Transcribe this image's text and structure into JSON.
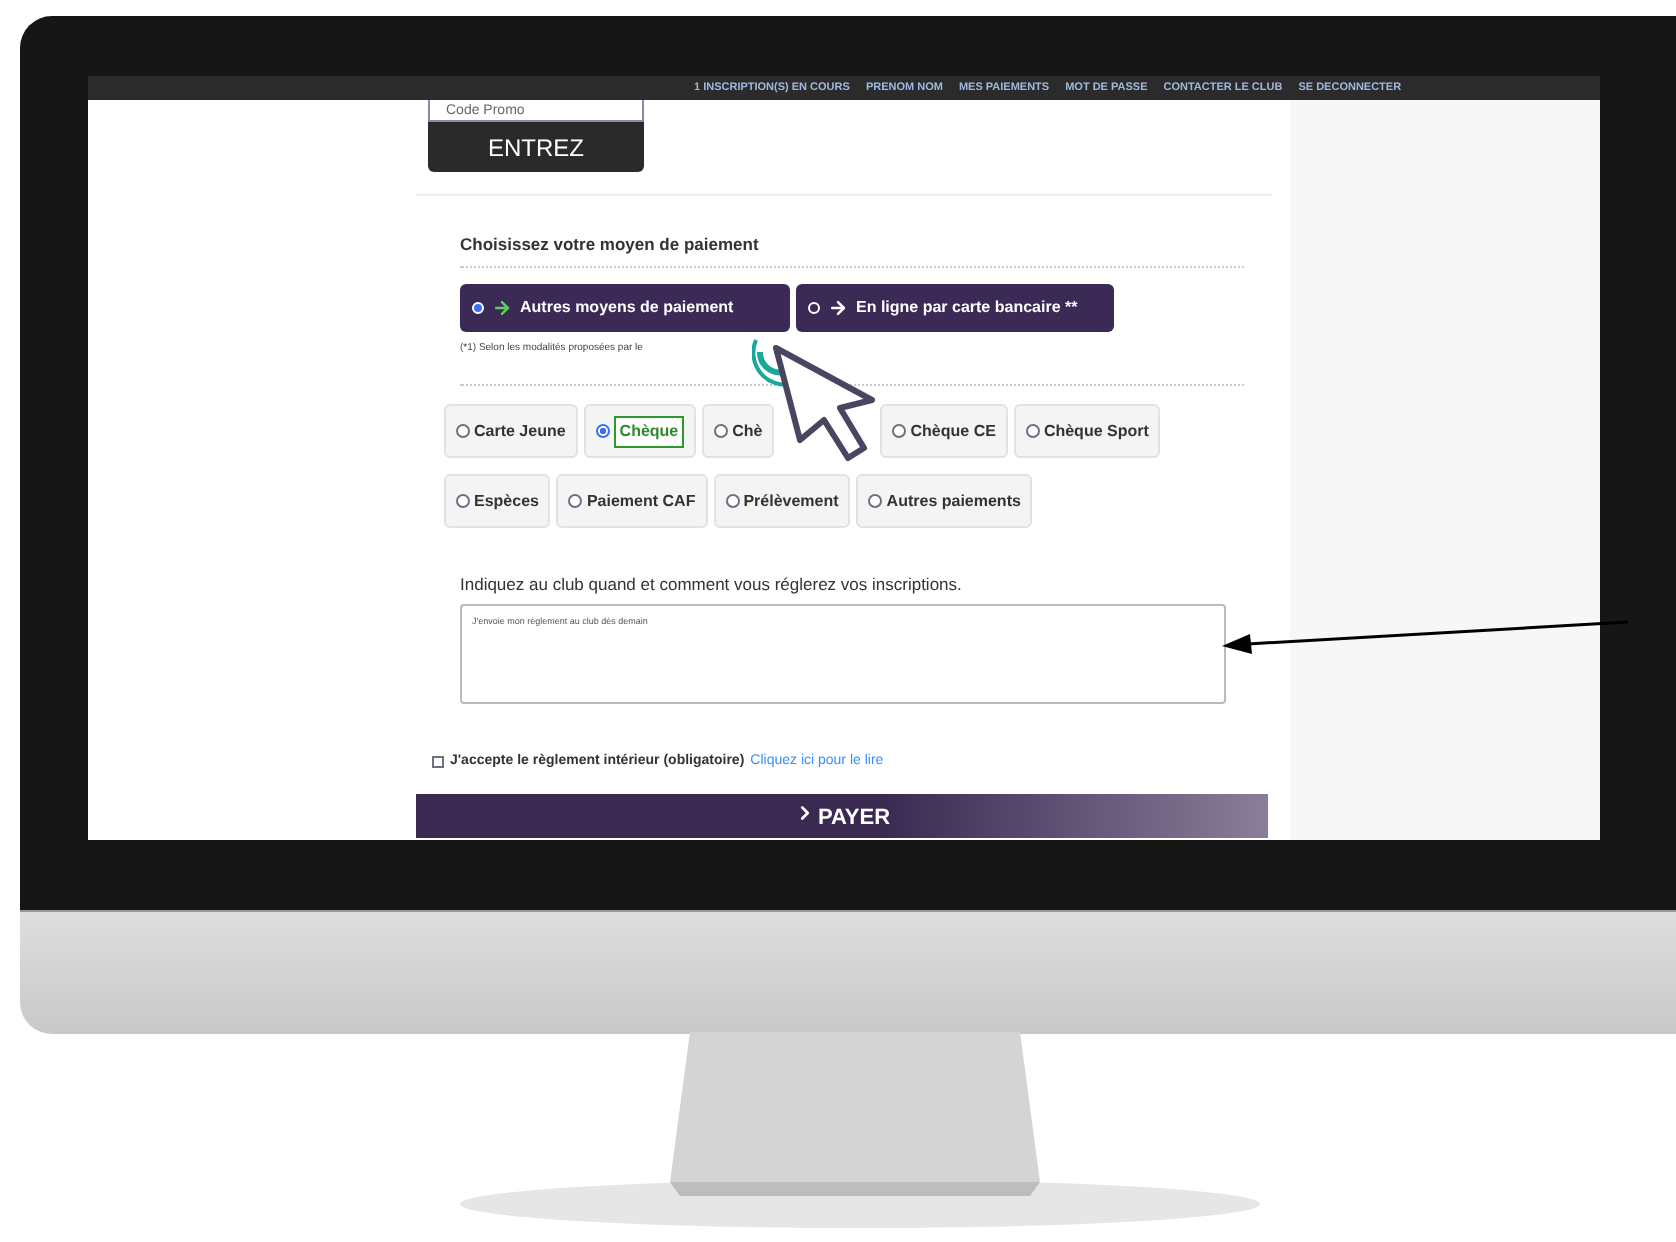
{
  "top_nav": {
    "links": [
      "1 INSCRIPTION(S) EN COURS",
      "PRENOM NOM",
      "MES PAIEMENTS",
      "MOT DE PASSE",
      "CONTACTER LE CLUB",
      "SE DECONNECTER"
    ]
  },
  "promo": {
    "placeholder": "Code Promo",
    "button": "ENTREZ"
  },
  "payment": {
    "heading": "Choisissez votre moyen de paiement",
    "modes": [
      {
        "label": "Autres moyens de paiement",
        "selected": true
      },
      {
        "label": "En ligne par carte bancaire **",
        "selected": false
      }
    ],
    "note": "(*1) Selon les modalités proposées par le"
  },
  "options": [
    {
      "label": "Carte Jeune",
      "selected": false
    },
    {
      "label": "Chèque",
      "selected": true
    },
    {
      "label": "Chè",
      "selected": false
    },
    {
      "label": "Chèque CE",
      "selected": false
    },
    {
      "label": "Chèque Sport",
      "selected": false
    },
    {
      "label": "Espèces",
      "selected": false
    },
    {
      "label": "Paiement CAF",
      "selected": false
    },
    {
      "label": "Prélèvement",
      "selected": false
    },
    {
      "label": "Autres paiements",
      "selected": false
    }
  ],
  "comment": {
    "label": "Indiquez au club quand et comment vous réglerez vos inscriptions.",
    "value": "J'envoie mon règlement au club dès demain"
  },
  "terms": {
    "checked": false,
    "text": "J'accepte le règlement intérieur (obligatoire)",
    "link": "Cliquez ici pour le lire"
  },
  "pay_button": "PAYER"
}
